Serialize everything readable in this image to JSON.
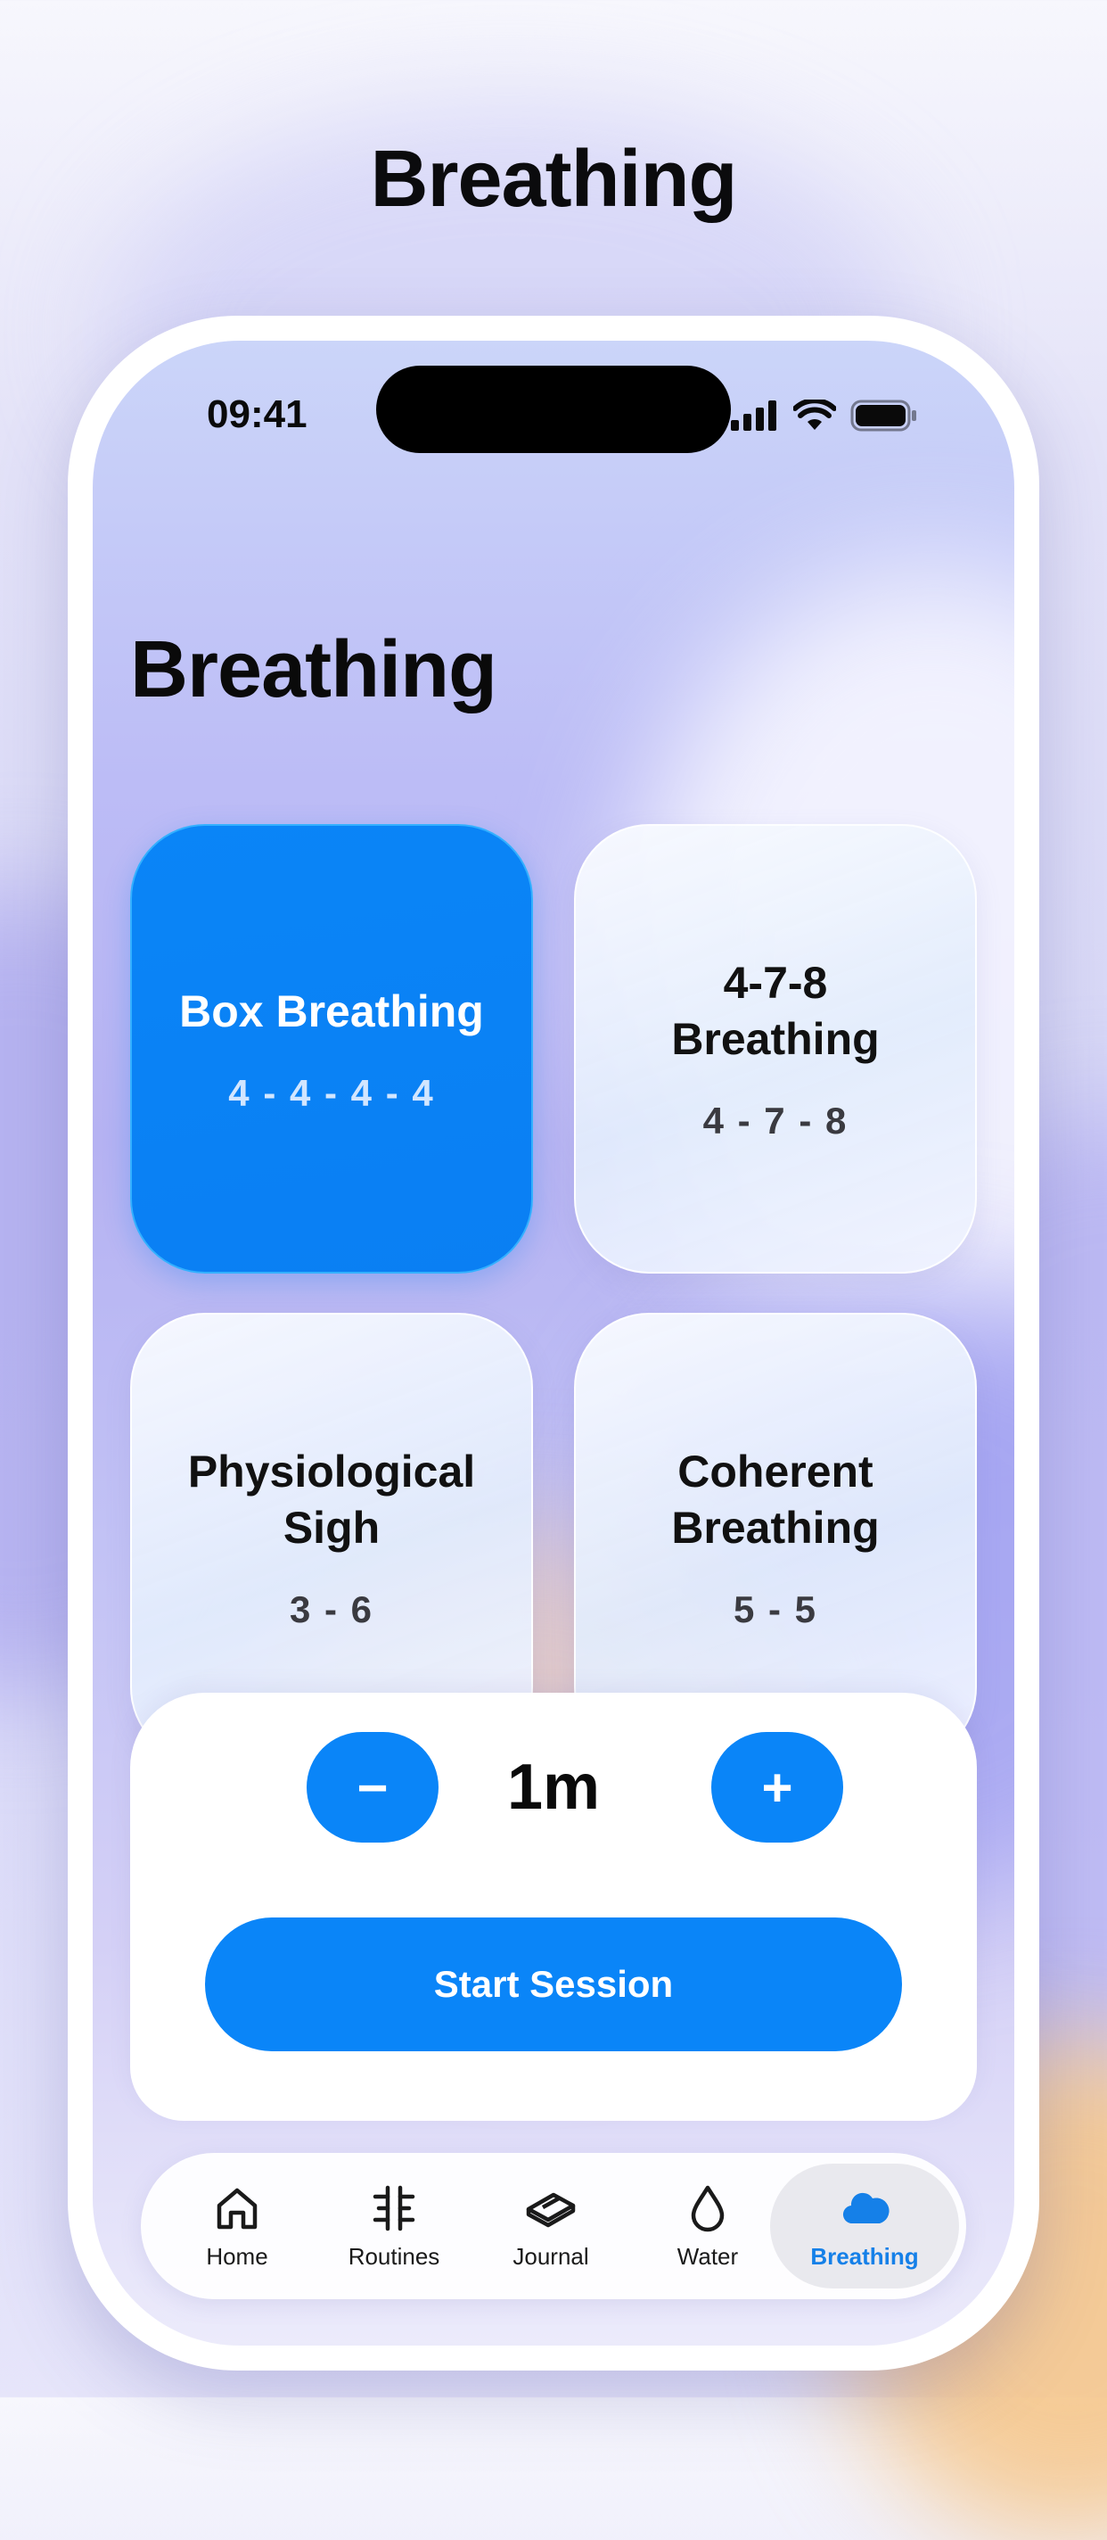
{
  "page_title": "Breathing",
  "status_bar": {
    "time": "09:41",
    "icons": [
      "signal-icon",
      "wifi-icon",
      "battery-icon"
    ]
  },
  "screen_title": "Breathing",
  "colors": {
    "accent": "#0A85F8",
    "active_tab_text": "#1580E8"
  },
  "exercises": [
    {
      "title": "Box Breathing",
      "pattern": "4 - 4 - 4 - 4",
      "selected": true
    },
    {
      "title": "4-7-8\nBreathing",
      "pattern": "4 - 7 - 8",
      "selected": false
    },
    {
      "title": "Physiological\nSigh",
      "pattern": "3 - 6",
      "selected": false
    },
    {
      "title": "Coherent\nBreathing",
      "pattern": "5 - 5",
      "selected": false
    }
  ],
  "session": {
    "minus_label": "−",
    "duration": "1m",
    "plus_label": "+",
    "start_label": "Start Session"
  },
  "tabs": [
    {
      "label": "Home",
      "icon": "home-icon"
    },
    {
      "label": "Routines",
      "icon": "routines-icon"
    },
    {
      "label": "Journal",
      "icon": "journal-icon"
    },
    {
      "label": "Water",
      "icon": "water-drop-icon"
    },
    {
      "label": "Breathing",
      "icon": "cloud-icon",
      "active": true
    }
  ]
}
